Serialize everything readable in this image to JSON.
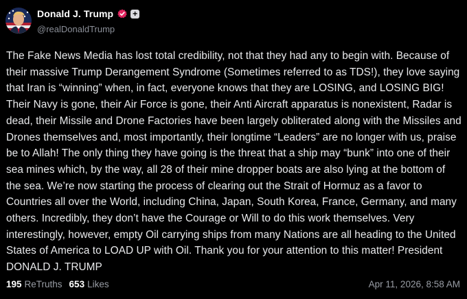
{
  "author": {
    "display_name": "Donald J. Trump",
    "handle": "@realDonaldTrump",
    "avatar_icon": "profile-avatar",
    "verified_icon": "verified-badge-icon",
    "verified_color": "#e0245e",
    "plus_badge": "+"
  },
  "post": {
    "text": "The Fake News Media has lost total credibility, not that they had any to begin with. Because of their massive Trump Derangement Syndrome (Sometimes referred to as TDS!), they love saying that Iran is “winning” when, in fact, everyone knows that they are LOSING, and LOSING BIG! Their Navy is gone, their Air Force is gone, their Anti Aircraft apparatus is nonexistent, Radar is dead, their Missile and Drone Factories have been largely obliterated along with the Missiles and Drones themselves and, most importantly, their longtime “Leaders” are no longer with us, praise be to Allah! The only thing they have going is the threat that a ship may “bunk” into one of their sea mines which, by the way, all 28 of their mine dropper boats are also lying at the bottom of the sea. We’re now starting the process of clearing out the Strait of Hormuz as a favor to Countries all over the World, including China, Japan, South Korea, France, Germany, and many others. Incredibly, they don’t have the Courage or Will to do this work themselves. Very interestingly, however, empty Oil carrying ships from many Nations are all heading to the United States of America to LOAD UP with Oil. Thank you for your attention to this matter! President DONALD J. TRUMP"
  },
  "stats": {
    "retruths_count": "195",
    "retruths_label": "ReTruths",
    "likes_count": "653",
    "likes_label": "Likes",
    "timestamp": "Apr 11, 2026, 8:58 AM"
  }
}
